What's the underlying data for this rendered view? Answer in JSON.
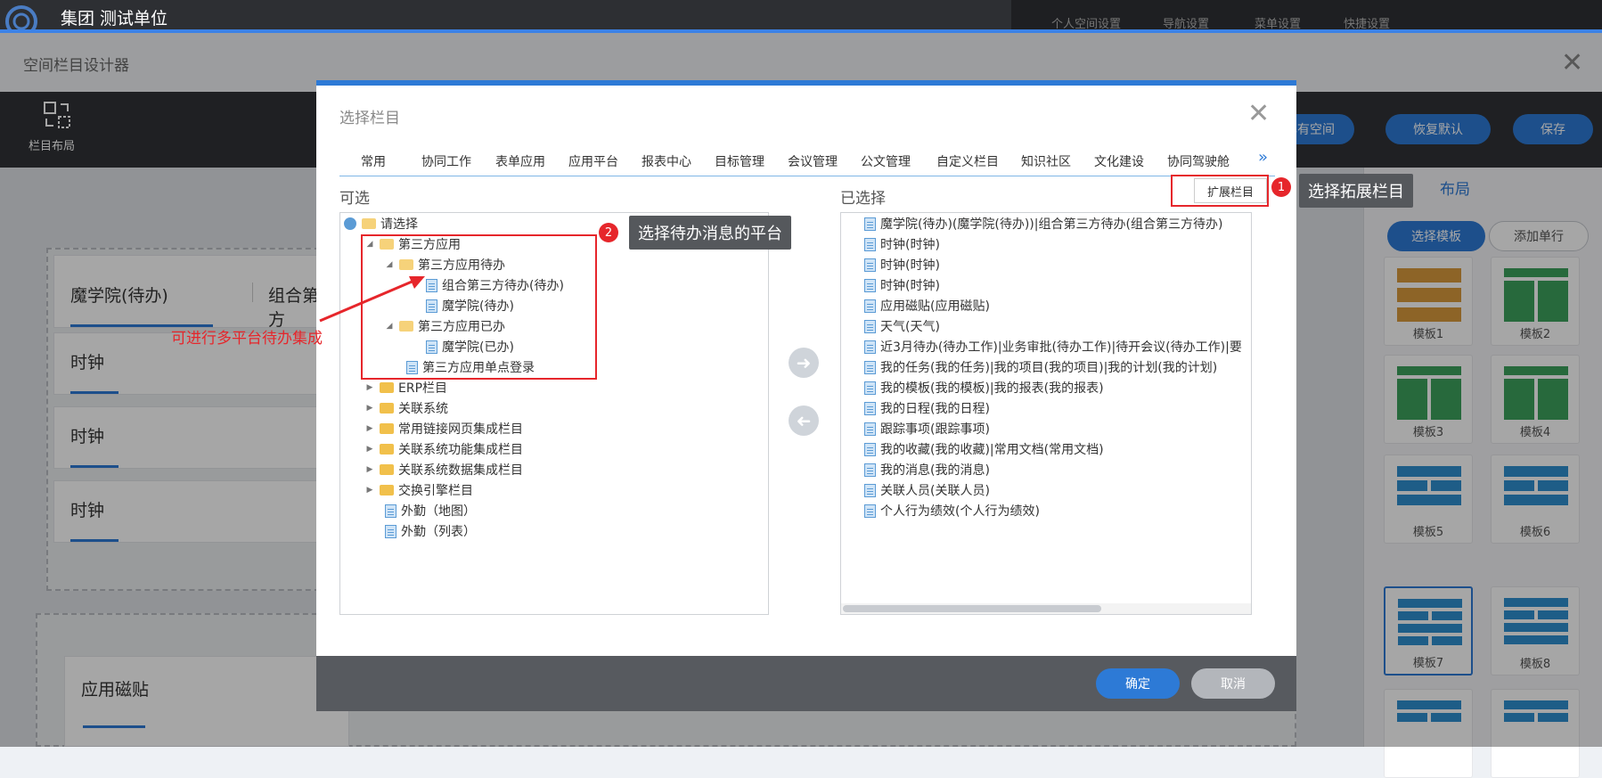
{
  "header": {
    "org": "集团   测试单位",
    "nav": [
      "个人空间设置",
      "导航设置",
      "菜单设置",
      "快捷设置"
    ]
  },
  "designer": {
    "title": "空间栏目设计器",
    "layout_label": "栏目布局",
    "buttons": {
      "existing_space": "已有空间",
      "restore_default": "恢复默认",
      "save": "保存"
    },
    "right_heading": "布局",
    "select_template": "选择模板",
    "add_row": "添加单行",
    "templates": [
      "模板1",
      "模板2",
      "模板3",
      "模板4",
      "模板5",
      "模板6",
      "模板7",
      "模板8"
    ],
    "cards": {
      "first_tabs": [
        "魔学院(待办)",
        "组合第三方"
      ],
      "clock": "时钟",
      "app_tile": "应用磁贴"
    }
  },
  "dialog": {
    "title": "选择栏目",
    "tabs": [
      "常用",
      "协同工作",
      "表单应用",
      "应用平台",
      "报表中心",
      "目标管理",
      "会议管理",
      "公文管理",
      "自定义栏目",
      "知识社区",
      "文化建设",
      "协同驾驶舱"
    ],
    "ext_button": "扩展栏目",
    "available_label": "可选",
    "selected_label": "已选择",
    "tree": {
      "root": "请选择",
      "third_party": "第三方应用",
      "pending": "第三方应用待办",
      "combo_pending": "组合第三方待办(待办)",
      "mxy_pending": "魔学院(待办)",
      "done": "第三方应用已办",
      "mxy_done": "魔学院(已办)",
      "sso": "第三方应用单点登录",
      "erp": "ERP栏目",
      "related": "关联系统",
      "links": "常用链接网页集成栏目",
      "func": "关联系统功能集成栏目",
      "data": "关联系统数据集成栏目",
      "exchange": "交换引擎栏目",
      "map": "外勤（地图）",
      "list": "外勤（列表）"
    },
    "selected": [
      "魔学院(待办)(魔学院(待办))|组合第三方待办(组合第三方待办)",
      "时钟(时钟)",
      "时钟(时钟)",
      "时钟(时钟)",
      "应用磁贴(应用磁贴)",
      "天气(天气)",
      "近3月待办(待办工作)|业务审批(待办工作)|待开会议(待办工作)|要",
      "我的任务(我的任务)|我的项目(我的项目)|我的计划(我的计划)",
      "我的模板(我的模板)|我的报表(我的报表)",
      "我的日程(我的日程)",
      "跟踪事项(跟踪事项)",
      "我的收藏(我的收藏)|常用文档(常用文档)",
      "我的消息(我的消息)",
      "关联人员(关联人员)",
      "个人行为绩效(个人行为绩效)"
    ],
    "ok": "确定",
    "cancel": "取消"
  },
  "annotations": {
    "badge1": "1",
    "note1": "选择拓展栏目",
    "badge2": "2",
    "note2": "选择待办消息的平台",
    "note3": "可进行多平台待办集成"
  },
  "colors": {
    "accent": "#2d7ad6",
    "annotation": "#e6262b"
  }
}
